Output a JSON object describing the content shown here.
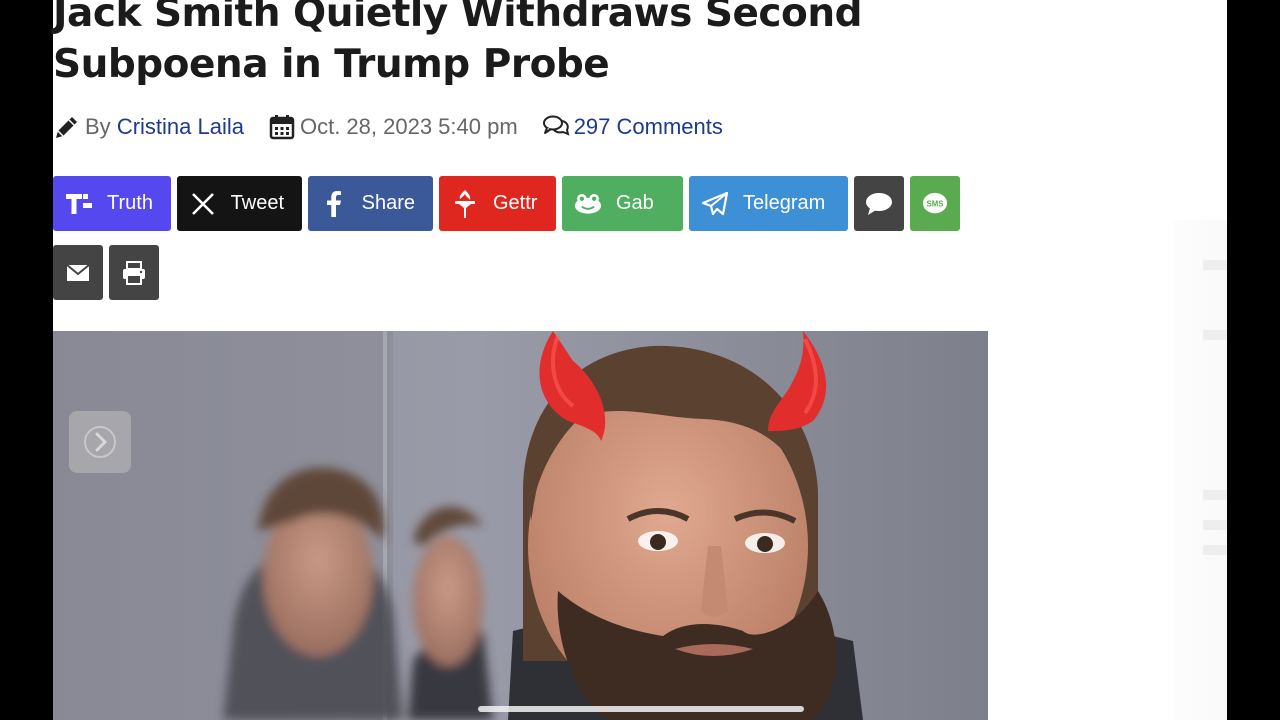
{
  "article": {
    "title_line1": "Jack Smith Quietly Withdraws Second",
    "title_line2": "Subpoena in Trump Probe",
    "by_label": "By",
    "author": "Cristina Laila",
    "date": "Oct. 28, 2023 5:40 pm",
    "comments": "297 Comments"
  },
  "share": {
    "truth": {
      "label": "Truth",
      "color": "#5448ee"
    },
    "tweet": {
      "label": "Tweet",
      "color": "#141414"
    },
    "share": {
      "label": "Share",
      "color": "#3b5998"
    },
    "gettr": {
      "label": "Gettr",
      "color": "#e0271f"
    },
    "gab": {
      "label": "Gab",
      "color": "#4fae60"
    },
    "telegram": {
      "label": "Telegram",
      "color": "#3d8fd6"
    },
    "comment": {
      "color": "#444444"
    },
    "sms": {
      "label": "SMS",
      "color": "#5aab4f"
    },
    "email": {
      "color": "#444444"
    },
    "print": {
      "color": "#444444"
    }
  },
  "icons": [
    "pencil-icon",
    "calendar-icon",
    "comments-icon",
    "truth-icon",
    "x-icon",
    "facebook-icon",
    "gettr-icon",
    "gab-icon",
    "telegram-icon",
    "comment-icon",
    "sms-icon",
    "email-icon",
    "print-icon",
    "chevron-right-icon"
  ]
}
